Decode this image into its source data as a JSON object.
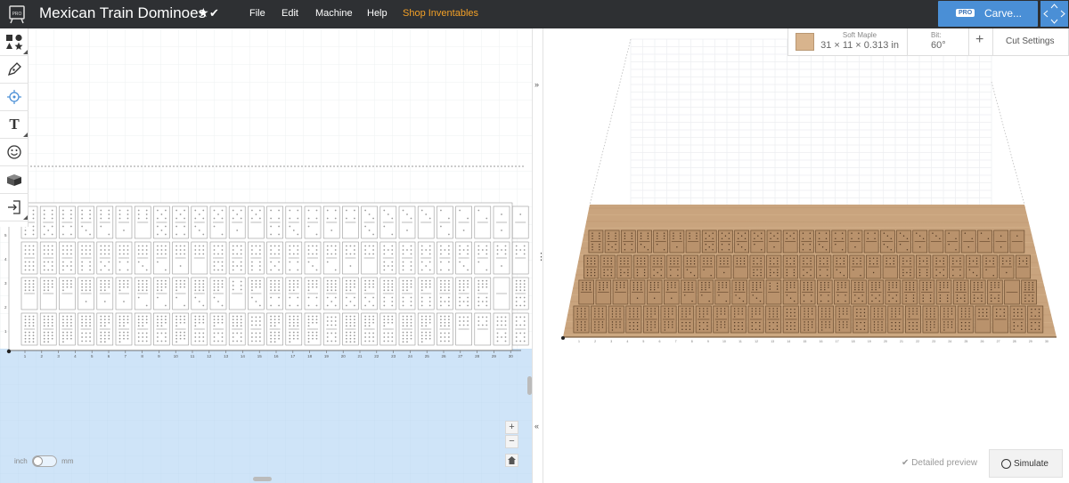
{
  "header": {
    "logo_badge": "PRO",
    "project_title": "Mexican Train Dominoes",
    "star_glyph": "★",
    "saved_glyph": "✔",
    "menu": [
      "File",
      "Edit",
      "Machine",
      "Help",
      "Shop Inventables"
    ],
    "carve_badge": "PRO",
    "carve_label": "Carve...",
    "accent_color": "#4a8fd6",
    "shop_color": "#f4a127"
  },
  "toolbar": {
    "tools": [
      "shapes-icon",
      "pen-icon",
      "target-icon",
      "text-icon",
      "smiley-icon",
      "box-icon",
      "import-icon"
    ],
    "text_tool_glyph": "T"
  },
  "units": {
    "left_label": "inch",
    "right_label": "mm",
    "selected": "inch"
  },
  "ruler": {
    "x_ticks": [
      "1",
      "2",
      "3",
      "4",
      "5",
      "6",
      "7",
      "8",
      "9",
      "10",
      "11",
      "12",
      "13",
      "14",
      "15",
      "16",
      "17",
      "18",
      "19",
      "20",
      "21",
      "22",
      "23",
      "24",
      "25",
      "26",
      "27",
      "28",
      "29",
      "30"
    ],
    "y_ticks": [
      "1",
      "2",
      "3",
      "4",
      "5",
      "6"
    ]
  },
  "zoom": {
    "in": "+",
    "out": "−",
    "home_icon": "home-icon"
  },
  "splitter": {
    "collapse_right": "»",
    "collapse_left": "«"
  },
  "material": {
    "name": "Soft Maple",
    "dimensions": "31 × 11 × 0.313 in",
    "swatch_color": "#d8b48d"
  },
  "bit": {
    "label": "Bit:",
    "value": "60°"
  },
  "add_glyph": "+",
  "cut_settings_label": "Cut Settings",
  "detailed_preview_label": "Detailed preview",
  "simulate_label": "Simulate",
  "dominoes": {
    "rows": [
      [
        "6/6",
        "6/5",
        "6/4",
        "6/3",
        "6/2",
        "6/1",
        "6/0",
        "5/5",
        "5/4",
        "5/3",
        "5/2",
        "5/1",
        "5/0",
        "4/4",
        "4/3",
        "4/2",
        "4/1",
        "4/0",
        "3/3",
        "3/2",
        "3/1",
        "3/0",
        "2/2",
        "2/1",
        "2/0",
        "1/1",
        "1/0"
      ],
      [
        "9/9",
        "9/8",
        "9/7",
        "9/6",
        "9/5",
        "9/4",
        "9/3",
        "9/2",
        "9/1",
        "9/0",
        "8/8",
        "8/7",
        "8/6",
        "8/5",
        "8/4",
        "8/3",
        "8/2",
        "8/1",
        "8/0",
        "7/7",
        "7/6",
        "7/5",
        "7/4",
        "7/3",
        "7/2",
        "7/1",
        "7/0"
      ],
      [
        "12/0",
        "11/0",
        "10/0",
        "12/1",
        "11/1",
        "10/1",
        "12/2",
        "11/2",
        "10/2",
        "12/3",
        "11/3",
        "6/0",
        "10/3",
        "12/4",
        "11/4",
        "10/4",
        "12/5",
        "11/5",
        "10/5",
        "12/6",
        "11/6",
        "10/6",
        "12/7",
        "11/7",
        "10/7",
        "0/0",
        "12/8"
      ],
      [
        "12/12",
        "12/11",
        "12/10",
        "12/9",
        "11/11",
        "11/10",
        "11/9",
        "11/8",
        "10/10",
        "10/9",
        "10/8",
        "12/8",
        "9/9",
        "11/11",
        "12/10",
        "10/10",
        "9/8",
        "12/12",
        "11/9",
        "10/9",
        "12/11",
        "11/10",
        "12/9",
        "9/0",
        "8/0",
        "9/7",
        "8/8"
      ]
    ]
  }
}
